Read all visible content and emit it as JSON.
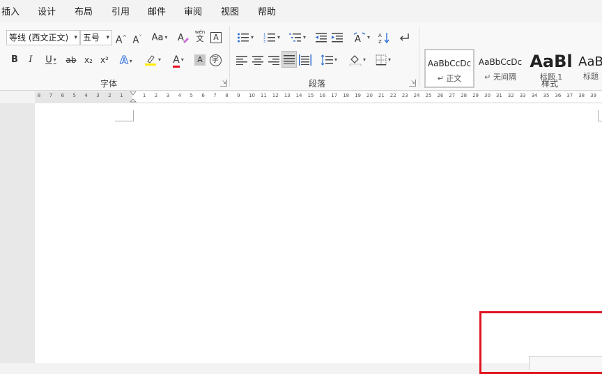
{
  "menu": {
    "items": [
      "插入",
      "设计",
      "布局",
      "引用",
      "邮件",
      "审阅",
      "视图",
      "帮助"
    ]
  },
  "font_group": {
    "label": "字体",
    "font_name": "等线 (西文正文)",
    "font_size": "五号",
    "grow_font": "A",
    "shrink_font": "A",
    "change_case": "Aa",
    "bold": "B",
    "italic": "I",
    "underline": "U",
    "strikethrough": "ab",
    "subscript": "x₂",
    "superscript": "x²",
    "text_effects": "A",
    "font_color": "A",
    "char_shading": "A",
    "enclose_char": "字",
    "phonetic_top": "wén",
    "phonetic_bottom": "文"
  },
  "paragraph_group": {
    "label": "段落"
  },
  "styles_group": {
    "label": "样式",
    "tiles": [
      {
        "sample": "AaBbCcDc",
        "name": "↵ 正文"
      },
      {
        "sample": "AaBbCcDc",
        "name": "↵ 无间隔"
      },
      {
        "sample": "AaBl",
        "name": "标题 1"
      },
      {
        "sample": "AaB",
        "name": "标题"
      }
    ]
  },
  "ruler": {
    "left_numbers": [
      "8",
      "7",
      "6",
      "5",
      "4",
      "3",
      "2",
      "1"
    ],
    "right_numbers": [
      "1",
      "2",
      "3",
      "4",
      "5",
      "6",
      "7",
      "8",
      "9",
      "10",
      "11",
      "12",
      "13",
      "14",
      "15",
      "16",
      "17",
      "18",
      "19",
      "20",
      "21",
      "22",
      "23",
      "24",
      "25",
      "26",
      "27",
      "28",
      "29",
      "30",
      "31",
      "32",
      "33",
      "34",
      "35",
      "36",
      "37",
      "38",
      "39"
    ]
  },
  "colors": {
    "highlight_yellow": "#ffeb00",
    "font_red": "#e81123",
    "text_effect_blue": "#2b6cd4",
    "selection_red_box": "#e0141e"
  }
}
